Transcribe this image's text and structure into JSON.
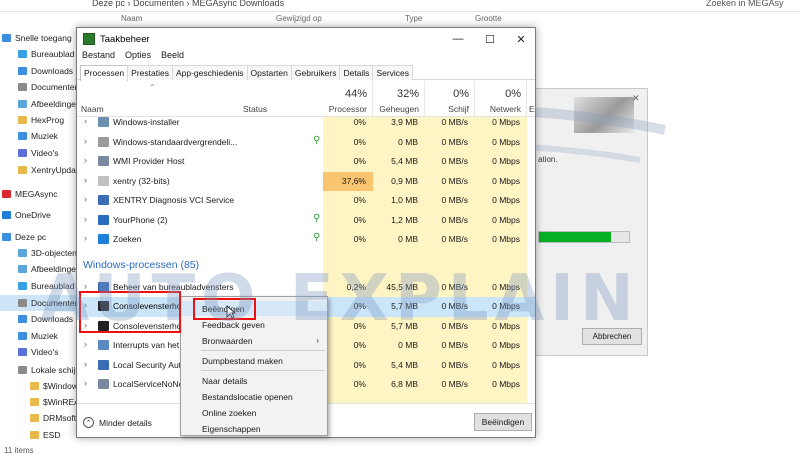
{
  "explorer": {
    "address": "Deze pc  ›  Documenten  ›  MEGAsync Downloads",
    "search_placeholder": "Zoeken in MEGAsy",
    "columns": [
      "Naam",
      "Gewijzigd op",
      "Type",
      "Grootte"
    ],
    "sidebar": [
      {
        "label": "Snelle toegang",
        "color": "#3c8fde"
      },
      {
        "label": "Bureaublad",
        "color": "#3aa0e6"
      },
      {
        "label": "Downloads",
        "color": "#3c8fde"
      },
      {
        "label": "Documenten",
        "color": "#8a8a8a"
      },
      {
        "label": "Afbeeldingen",
        "color": "#5aa6d8"
      },
      {
        "label": "HexProg",
        "color": "#e8b84a"
      },
      {
        "label": "Muziek",
        "color": "#3c8fde"
      },
      {
        "label": "Video's",
        "color": "#5a6fd8"
      },
      {
        "label": "XentryUpdate",
        "color": "#e8b84a"
      },
      {
        "label": "MEGAsync",
        "color": "#d9272e"
      },
      {
        "label": "OneDrive",
        "color": "#1e7fd8"
      },
      {
        "label": "Deze pc",
        "color": "#3c8fde"
      },
      {
        "label": "3D-objecten",
        "color": "#5aa6d8"
      },
      {
        "label": "Afbeeldingen",
        "color": "#5aa6d8"
      },
      {
        "label": "Bureaublad",
        "color": "#3aa0e6"
      },
      {
        "label": "Documenten",
        "color": "#8a8a8a"
      },
      {
        "label": "Downloads",
        "color": "#3c8fde"
      },
      {
        "label": "Muziek",
        "color": "#3c8fde"
      },
      {
        "label": "Video's",
        "color": "#5a6fd8"
      },
      {
        "label": "Lokale schijf",
        "color": "#8a8a8a"
      },
      {
        "label": "$Windows",
        "color": "#e8b84a"
      },
      {
        "label": "$WinREAgent",
        "color": "#e8b84a"
      },
      {
        "label": "DRMsoft",
        "color": "#e8b84a"
      },
      {
        "label": "ESD",
        "color": "#e8b84a"
      }
    ],
    "status": "11 items"
  },
  "mega_window": {
    "text": "ation.",
    "progress": 0.8,
    "cancel_label": "Abbrechen",
    "close_glyph": "✕"
  },
  "taskmanager": {
    "title": "Taakbeheer",
    "menu": [
      "Bestand",
      "Opties",
      "Beeld"
    ],
    "tabs": [
      "Processen",
      "Prestaties",
      "App-geschiedenis",
      "Opstarten",
      "Gebruikers",
      "Details",
      "Services"
    ],
    "active_tab": 0,
    "header": {
      "name": "Naam",
      "status": "Status",
      "cpu_pct": "44%",
      "cpu": "Processor",
      "mem_pct": "32%",
      "mem": "Geheugen",
      "disk_pct": "0%",
      "disk": "Schijf",
      "net_pct": "0%",
      "net": "Netwerk",
      "extra": "E"
    },
    "rows_top": [
      {
        "name": "Windows-installer",
        "leaf": false,
        "cpu": "0%",
        "mem": "3,9 MB",
        "disk": "0 MB/s",
        "net": "0 Mbps",
        "icon": "#6d8fb0"
      },
      {
        "name": "Windows-standaardvergrendeli...",
        "leaf": true,
        "cpu": "0%",
        "mem": "0 MB",
        "disk": "0 MB/s",
        "net": "0 Mbps",
        "icon": "#9a9a9a"
      },
      {
        "name": "WMI Provider Host",
        "leaf": false,
        "cpu": "0%",
        "mem": "5,4 MB",
        "disk": "0 MB/s",
        "net": "0 Mbps",
        "icon": "#7a8aa0"
      },
      {
        "name": "xentry (32-bits)",
        "leaf": false,
        "cpu": "37,6%",
        "mem": "0,9 MB",
        "disk": "0 MB/s",
        "net": "0 Mbps",
        "icon": "#c0c0c0",
        "hot": true
      },
      {
        "name": "XENTRY Diagnosis VCI Service",
        "leaf": false,
        "cpu": "0%",
        "mem": "1,0 MB",
        "disk": "0 MB/s",
        "net": "0 Mbps",
        "icon": "#3a6db5"
      },
      {
        "name": "YourPhone (2)",
        "leaf": true,
        "cpu": "0%",
        "mem": "1,2 MB",
        "disk": "0 MB/s",
        "net": "0 Mbps",
        "icon": "#2a6bbf"
      },
      {
        "name": "Zoeken",
        "leaf": true,
        "cpu": "0%",
        "mem": "0 MB",
        "disk": "0 MB/s",
        "net": "0 Mbps",
        "icon": "#1e7fd8"
      }
    ],
    "group_label": "Windows-processen (85)",
    "rows_win": [
      {
        "name": "Beheer van bureaubladvensters",
        "cpu": "0,2%",
        "mem": "45,5 MB",
        "disk": "0 MB/s",
        "net": "0 Mbps",
        "icon": "#3a6db5"
      },
      {
        "name": "Consolevensterho",
        "cpu": "0%",
        "mem": "5,7 MB",
        "disk": "0 MB/s",
        "net": "0 Mbps",
        "icon": "#222222",
        "selected": true
      },
      {
        "name": "Consolevensterho",
        "cpu": "0%",
        "mem": "5,7 MB",
        "disk": "0 MB/s",
        "net": "0 Mbps",
        "icon": "#222222"
      },
      {
        "name": "Interrupts van het",
        "cpu": "0%",
        "mem": "0 MB",
        "disk": "0 MB/s",
        "net": "0 Mbps",
        "icon": "#5a8ac0"
      },
      {
        "name": "Local Security Aut",
        "cpu": "0%",
        "mem": "5,4 MB",
        "disk": "0 MB/s",
        "net": "0 Mbps",
        "icon": "#3a6db5"
      },
      {
        "name": "LocalServiceNoNe",
        "cpu": "0%",
        "mem": "6,8 MB",
        "disk": "0 MB/s",
        "net": "0 Mbps",
        "icon": "#7a8aa0"
      }
    ],
    "footer": {
      "less_details": "Minder details",
      "end_task": "Beëindigen"
    }
  },
  "context_menu": {
    "items": [
      {
        "label": "Beëindigen",
        "hover": true
      },
      {
        "label": "Feedback geven"
      },
      {
        "label": "Bronwaarden",
        "submenu": true
      },
      {
        "label": "Dumpbestand maken"
      },
      {
        "label": "Naar details"
      },
      {
        "label": "Bestandslocatie openen"
      },
      {
        "label": "Online zoeken"
      },
      {
        "label": "Eigenschappen"
      }
    ]
  },
  "watermark": "AUTO EXPLAIN",
  "colors": {
    "highlight_red": "#ee1111",
    "cpu_hot": "#f9c570",
    "cell_bg": "#fff4c4",
    "group_blue": "#2a6bbf",
    "selection": "#cce6f9"
  }
}
